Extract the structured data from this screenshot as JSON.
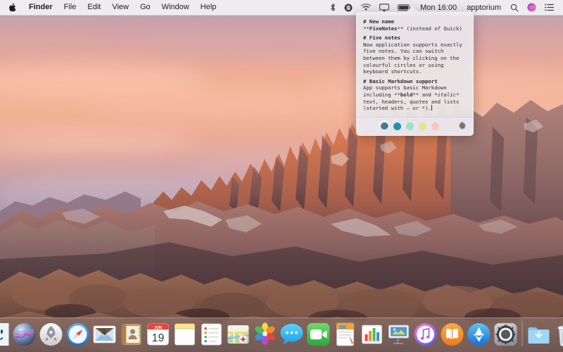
{
  "menubar": {
    "apple_icon": "apple-logo-icon",
    "app_name": "Finder",
    "menus": [
      "File",
      "Edit",
      "View",
      "Go",
      "Window",
      "Help"
    ],
    "status_icons": [
      {
        "name": "bluetooth-icon",
        "glyph": "bluetooth"
      },
      {
        "name": "fivenotes-menu-icon",
        "glyph": "notes-circle"
      },
      {
        "name": "wifi-icon",
        "glyph": "wifi"
      },
      {
        "name": "airplay-icon",
        "glyph": "airplay"
      },
      {
        "name": "battery-icon",
        "glyph": "battery"
      }
    ],
    "clock": "Mon 16:00",
    "user": "apptorium",
    "search_icon": "spotlight-search-icon",
    "siri_icon": "siri-icon",
    "notification_icon": "notification-center-icon"
  },
  "popover": {
    "sections": [
      {
        "heading": "# New name",
        "lines": [
          {
            "parts": [
              {
                "t": "**",
                "s": "plain"
              },
              {
                "t": "FiveNotes",
                "s": "bold"
              },
              {
                "t": "** (instead of Quick)",
                "s": "plain"
              }
            ]
          }
        ]
      },
      {
        "heading": "# Five notes",
        "lines": [
          {
            "parts": [
              {
                "t": "Now application supports exactly",
                "s": "plain"
              }
            ]
          },
          {
            "parts": [
              {
                "t": "five notes. You can switch",
                "s": "plain"
              }
            ]
          },
          {
            "parts": [
              {
                "t": "between them by clicking on the",
                "s": "plain"
              }
            ]
          },
          {
            "parts": [
              {
                "t": "colourful circles or using",
                "s": "plain"
              }
            ]
          },
          {
            "parts": [
              {
                "t": "keyboard shortcuts.",
                "s": "plain"
              }
            ]
          }
        ]
      },
      {
        "heading": "# Basic Markdown support",
        "lines": [
          {
            "parts": [
              {
                "t": "App supports basic Markdown",
                "s": "plain"
              }
            ]
          },
          {
            "parts": [
              {
                "t": "including **",
                "s": "plain"
              },
              {
                "t": "bold",
                "s": "bold"
              },
              {
                "t": "** and *",
                "s": "plain"
              },
              {
                "t": "italic",
                "s": "italic"
              },
              {
                "t": "*",
                "s": "plain"
              }
            ]
          },
          {
            "parts": [
              {
                "t": "text, headers, quotes and lists",
                "s": "plain"
              }
            ]
          },
          {
            "parts": [
              {
                "t": "(started with – or *).",
                "s": "plain"
              },
              {
                "t": "",
                "s": "caret"
              }
            ]
          }
        ]
      }
    ],
    "note_colors": [
      {
        "name": "note-color-teal",
        "hex": "#3f8087",
        "selected": true
      },
      {
        "name": "note-color-blue",
        "hex": "#1f94ad",
        "selected": false
      },
      {
        "name": "note-color-green",
        "hex": "#96e6c0",
        "selected": false
      },
      {
        "name": "note-color-yellow",
        "hex": "#dbe98a",
        "selected": false
      },
      {
        "name": "note-color-pink",
        "hex": "#fcc6ba",
        "selected": false
      }
    ],
    "settings_icon": "gear-icon"
  },
  "dock": {
    "items": [
      {
        "name": "dock-item-finder",
        "label": "Finder",
        "running": true
      },
      {
        "name": "dock-item-siri",
        "label": "Siri",
        "running": false
      },
      {
        "name": "dock-item-launchpad",
        "label": "Launchpad",
        "running": false
      },
      {
        "name": "dock-item-safari",
        "label": "Safari",
        "running": false
      },
      {
        "name": "dock-item-mail",
        "label": "Mail",
        "running": false
      },
      {
        "name": "dock-item-contacts",
        "label": "Contacts",
        "running": false
      },
      {
        "name": "dock-item-calendar",
        "label": "Calendar",
        "running": false
      },
      {
        "name": "dock-item-notes",
        "label": "Notes",
        "running": false
      },
      {
        "name": "dock-item-reminders",
        "label": "Reminders",
        "running": false
      },
      {
        "name": "dock-item-maps",
        "label": "Maps",
        "running": false
      },
      {
        "name": "dock-item-photos",
        "label": "Photos",
        "running": false
      },
      {
        "name": "dock-item-messages",
        "label": "Messages",
        "running": false
      },
      {
        "name": "dock-item-facetime",
        "label": "FaceTime",
        "running": false
      },
      {
        "name": "dock-item-pages",
        "label": "Pages",
        "running": false
      },
      {
        "name": "dock-item-numbers",
        "label": "Numbers",
        "running": false
      },
      {
        "name": "dock-item-keynote",
        "label": "Keynote",
        "running": false
      },
      {
        "name": "dock-item-itunes",
        "label": "iTunes",
        "running": false
      },
      {
        "name": "dock-item-ibooks",
        "label": "iBooks",
        "running": false
      },
      {
        "name": "dock-item-app-store",
        "label": "App Store",
        "running": false
      },
      {
        "name": "dock-item-system-preferences",
        "label": "System Preferences",
        "running": false
      },
      {
        "name": "dock-item-downloads",
        "label": "Downloads",
        "running": false
      },
      {
        "name": "dock-item-trash",
        "label": "Trash",
        "running": false
      }
    ],
    "calendar_month": "JUN",
    "calendar_day": "19"
  }
}
